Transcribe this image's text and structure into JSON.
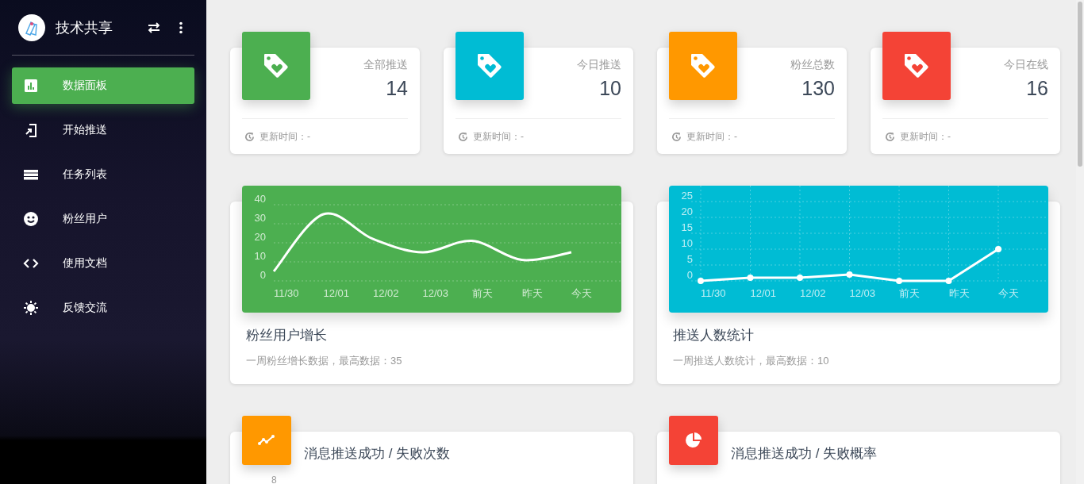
{
  "sidebar": {
    "brand": "技术共享",
    "items": [
      {
        "label": "数据面板",
        "selected": true
      },
      {
        "label": "开始推送",
        "selected": false
      },
      {
        "label": "任务列表",
        "selected": false
      },
      {
        "label": "粉丝用户",
        "selected": false
      },
      {
        "label": "使用文档",
        "selected": false
      },
      {
        "label": "反馈交流",
        "selected": false
      }
    ]
  },
  "stats": [
    {
      "label": "全部推送",
      "value": "14",
      "footer": "更新时间：-",
      "color": "#4caf50"
    },
    {
      "label": "今日推送",
      "value": "10",
      "footer": "更新时间：-",
      "color": "#00bcd4"
    },
    {
      "label": "粉丝总数",
      "value": "130",
      "footer": "更新时间：-",
      "color": "#ff9800"
    },
    {
      "label": "今日在线",
      "value": "16",
      "footer": "更新时间：-",
      "color": "#f44336"
    }
  ],
  "charts": [
    {
      "title": "粉丝用户增长",
      "subtitle": "一周粉丝增长数据，最高数据：35",
      "color": "#4caf50",
      "chart_data": {
        "type": "line",
        "categories": [
          "11/30",
          "12/01",
          "12/02",
          "12/03",
          "前天",
          "昨天",
          "今天"
        ],
        "ylim": [
          0,
          40
        ],
        "yticks": [
          0,
          10,
          20,
          30,
          40
        ],
        "grid": "y",
        "series": [
          {
            "color": "#ffffff",
            "marker": false,
            "values": [
              5,
              35,
              22,
              15,
              21,
              11,
              15
            ]
          }
        ]
      }
    },
    {
      "title": "推送人数统计",
      "subtitle": "一周推送人数统计，最高数据：10",
      "color": "#00bcd4",
      "chart_data": {
        "type": "line",
        "categories": [
          "11/30",
          "12/01",
          "12/02",
          "12/03",
          "前天",
          "昨天",
          "今天"
        ],
        "ylim": [
          0,
          25
        ],
        "yticks": [
          0,
          5,
          10,
          15,
          20,
          25
        ],
        "grid": "both",
        "series": [
          {
            "color": "#ffffff",
            "marker": true,
            "values": [
              0,
              1,
              1,
              2,
              0,
              0,
              10
            ]
          }
        ]
      }
    }
  ],
  "panels": [
    {
      "kind": "line",
      "title": "消息推送成功 / 失败次数",
      "color": "#ff9800",
      "axis_label": "8"
    },
    {
      "kind": "pie",
      "title": "消息推送成功 / 失败概率",
      "color": "#f44336"
    }
  ]
}
